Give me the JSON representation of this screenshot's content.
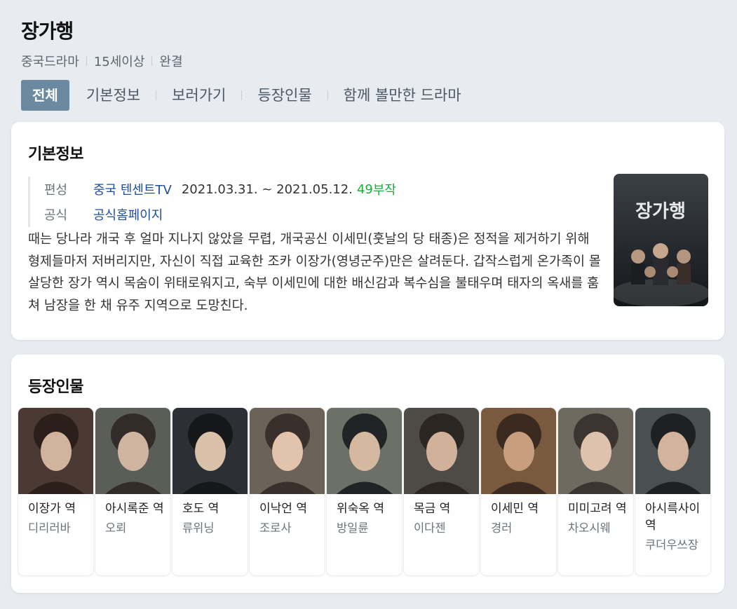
{
  "header": {
    "title": "장가행",
    "meta": [
      "중국드라마",
      "15세이상",
      "완결"
    ],
    "tabs": [
      "전체",
      "기본정보",
      "보러가기",
      "등장인물",
      "함께 볼만한 드라마"
    ]
  },
  "basic_info": {
    "section_title": "기본정보",
    "broadcast_label": "편성",
    "broadcaster": "중국 텐센트TV",
    "date_range": "2021.03.31. ~ 2021.05.12.",
    "episodes_number": "49",
    "episodes_suffix": "부작",
    "official_label": "공식",
    "official_link": "공식홈페이지",
    "description": "때는 당나라 개국 후 얼마 지나지 않았을 무렵, 개국공신 이세민(훗날의 당 태종)은 정적을 제거하기 위해 형제들마저 저버리지만, 자신이 직접 교육한 조카 이장가(영녕군주)만은 살려둔다. 갑작스럽게 온가족이 몰살당한 장가 역시 목숨이 위태로워지고, 숙부 이세민에 대한 배신감과 복수심을 불태우며 태자의 옥새를 훔쳐 남장을 한 채 유주 지역으로 도망친다.",
    "poster_title": "장가행"
  },
  "cast": {
    "section_title": "등장인물",
    "members": [
      {
        "role": "이장가 역",
        "actor": "디리러바"
      },
      {
        "role": "아시록준 역",
        "actor": "오뢰"
      },
      {
        "role": "호도 역",
        "actor": "류위닝"
      },
      {
        "role": "이낙언 역",
        "actor": "조로사"
      },
      {
        "role": "위숙옥 역",
        "actor": "방일륜"
      },
      {
        "role": "목금 역",
        "actor": "이다젠"
      },
      {
        "role": "이세민 역",
        "actor": "경러"
      },
      {
        "role": "미미고려 역",
        "actor": "차오시웨"
      },
      {
        "role": "아시륵사이 역",
        "actor": "쿠더우쓰장"
      }
    ]
  }
}
